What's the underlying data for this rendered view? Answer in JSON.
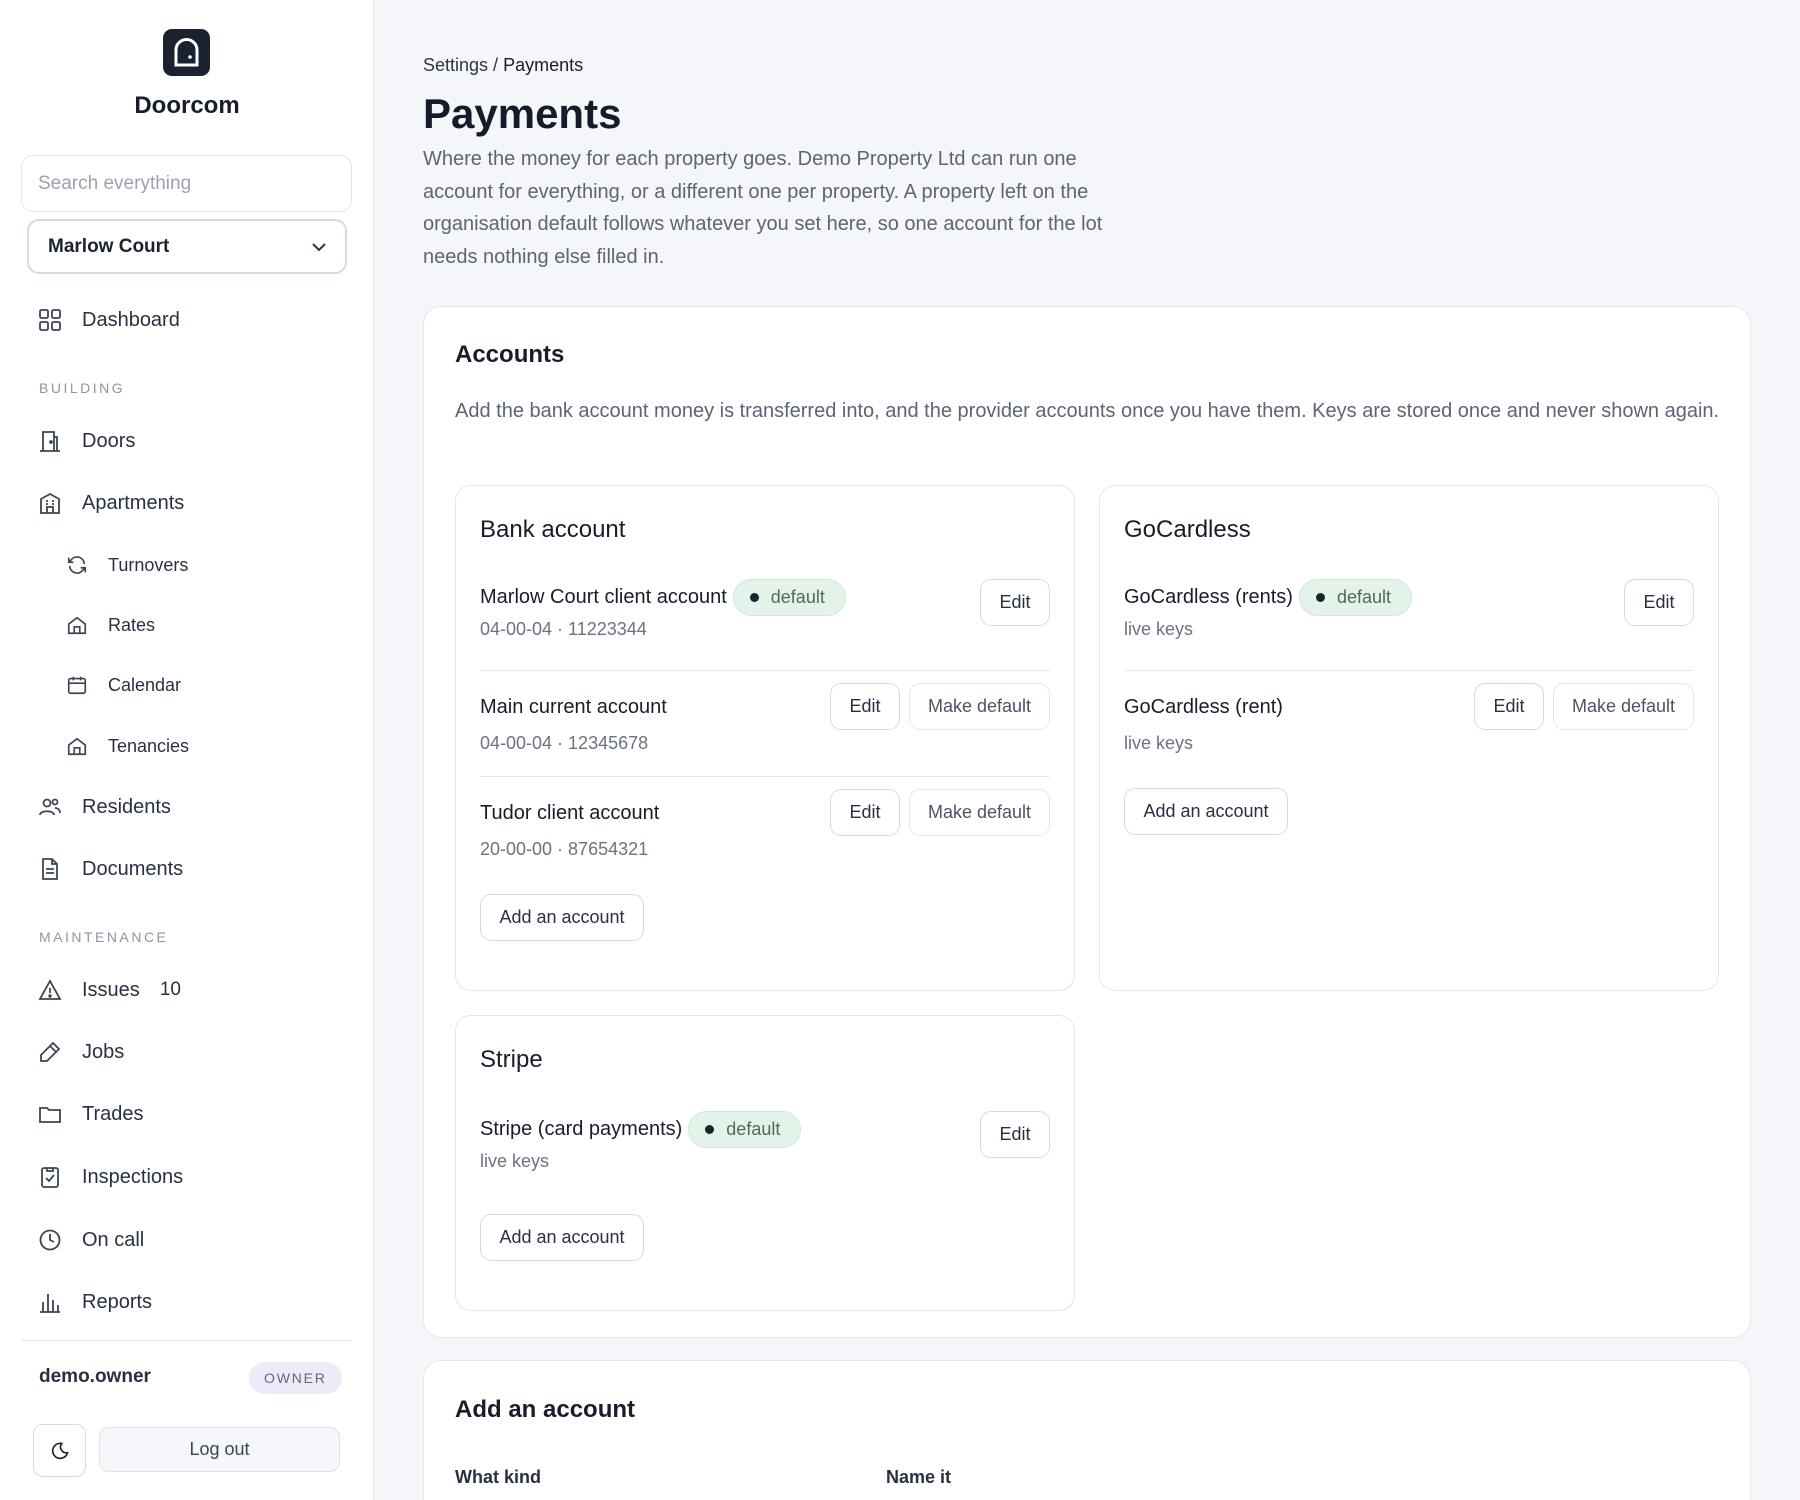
{
  "app": {
    "name": "Doorcom"
  },
  "sidebar": {
    "search_placeholder": "Search everything",
    "property": "Marlow Court",
    "dashboard": "Dashboard",
    "section_building": "BUILDING",
    "doors": "Doors",
    "apartments": "Apartments",
    "turnovers": "Turnovers",
    "rates": "Rates",
    "calendar": "Calendar",
    "tenancies": "Tenancies",
    "residents": "Residents",
    "documents": "Documents",
    "section_maintenance": "MAINTENANCE",
    "issues": "Issues",
    "issues_count": "10",
    "jobs": "Jobs",
    "trades": "Trades",
    "inspections": "Inspections",
    "on_call": "On call",
    "reports": "Reports",
    "user": "demo.owner",
    "role": "OWNER",
    "logout": "Log out"
  },
  "page": {
    "breadcrumb_parent": "Settings",
    "breadcrumb_sep": " / ",
    "breadcrumb_current": "Payments",
    "title": "Payments",
    "description": "Where the money for each property goes. Demo Property Ltd can run one account for everything, or a different one per property. A property left on the organisation default follows whatever you set here, so one account for the lot needs nothing else filled in."
  },
  "accounts": {
    "title": "Accounts",
    "description": "Add the bank account money is transferred into, and the provider accounts once you have them. Keys are stored once and never shown again.",
    "edit_label": "Edit",
    "make_default_label": "Make default",
    "add_label": "Add an account",
    "default_label": "default",
    "bank": {
      "title": "Bank account",
      "items": [
        {
          "name": "Marlow Court client account",
          "sub": "04-00-04 · 11223344"
        },
        {
          "name": "Main current account",
          "sub": "04-00-04 · 12345678"
        },
        {
          "name": "Tudor client account",
          "sub": "20-00-00 · 87654321"
        }
      ]
    },
    "gocardless": {
      "title": "GoCardless",
      "items": [
        {
          "name": "GoCardless (rents)",
          "sub": "live keys"
        },
        {
          "name": "GoCardless (rent)",
          "sub": "live keys"
        }
      ]
    },
    "stripe": {
      "title": "Stripe",
      "items": [
        {
          "name": "Stripe (card payments)",
          "sub": "live keys"
        }
      ]
    }
  },
  "add_account": {
    "title": "Add an account",
    "what_kind": "What kind",
    "name_it": "Name it"
  },
  "colors": {
    "accent_dark": "#1a2130",
    "default_badge_bg": "#e4f3ea",
    "role_badge_bg": "#eeeaf7"
  },
  "icons": [
    "door-logo-icon",
    "chevron-down-icon",
    "grid-icon",
    "door-icon",
    "building-icon",
    "refresh-icon",
    "home-icon",
    "calendar-icon",
    "users-icon",
    "document-icon",
    "warning-icon",
    "wrench-icon",
    "folder-icon",
    "clipboard-check-icon",
    "clock-icon",
    "bar-chart-icon",
    "moon-icon"
  ]
}
